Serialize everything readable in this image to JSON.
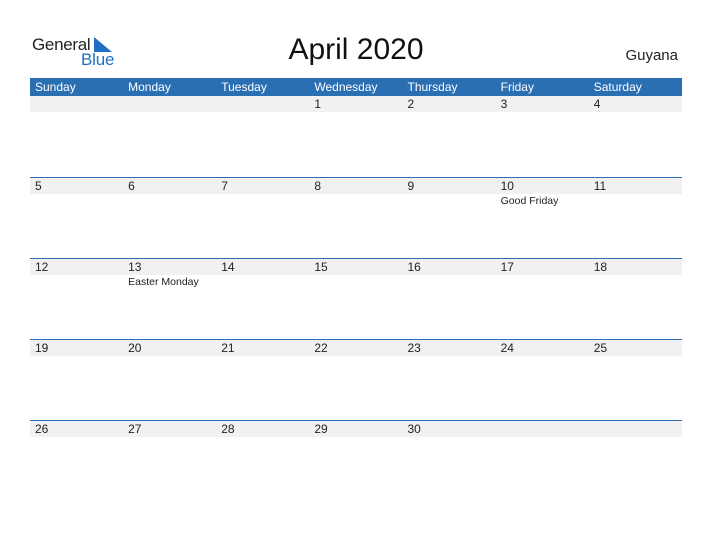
{
  "logo": {
    "word1": "General",
    "word2": "Blue"
  },
  "title": "April 2020",
  "country": "Guyana",
  "colors": {
    "accent": "#2b6fb3",
    "logo_blue": "#1f6fc5",
    "date_strip": "#f1f1f1"
  },
  "weekdays": [
    "Sunday",
    "Monday",
    "Tuesday",
    "Wednesday",
    "Thursday",
    "Friday",
    "Saturday"
  ],
  "weeks": [
    {
      "days": [
        "",
        "",
        "",
        "1",
        "2",
        "3",
        "4"
      ],
      "events": [
        "",
        "",
        "",
        "",
        "",
        "",
        ""
      ]
    },
    {
      "days": [
        "5",
        "6",
        "7",
        "8",
        "9",
        "10",
        "11"
      ],
      "events": [
        "",
        "",
        "",
        "",
        "",
        "Good Friday",
        ""
      ]
    },
    {
      "days": [
        "12",
        "13",
        "14",
        "15",
        "16",
        "17",
        "18"
      ],
      "events": [
        "",
        "Easter Monday",
        "",
        "",
        "",
        "",
        ""
      ]
    },
    {
      "days": [
        "19",
        "20",
        "21",
        "22",
        "23",
        "24",
        "25"
      ],
      "events": [
        "",
        "",
        "",
        "",
        "",
        "",
        ""
      ]
    },
    {
      "days": [
        "26",
        "27",
        "28",
        "29",
        "30",
        "",
        ""
      ],
      "events": [
        "",
        "",
        "",
        "",
        "",
        "",
        ""
      ]
    }
  ]
}
